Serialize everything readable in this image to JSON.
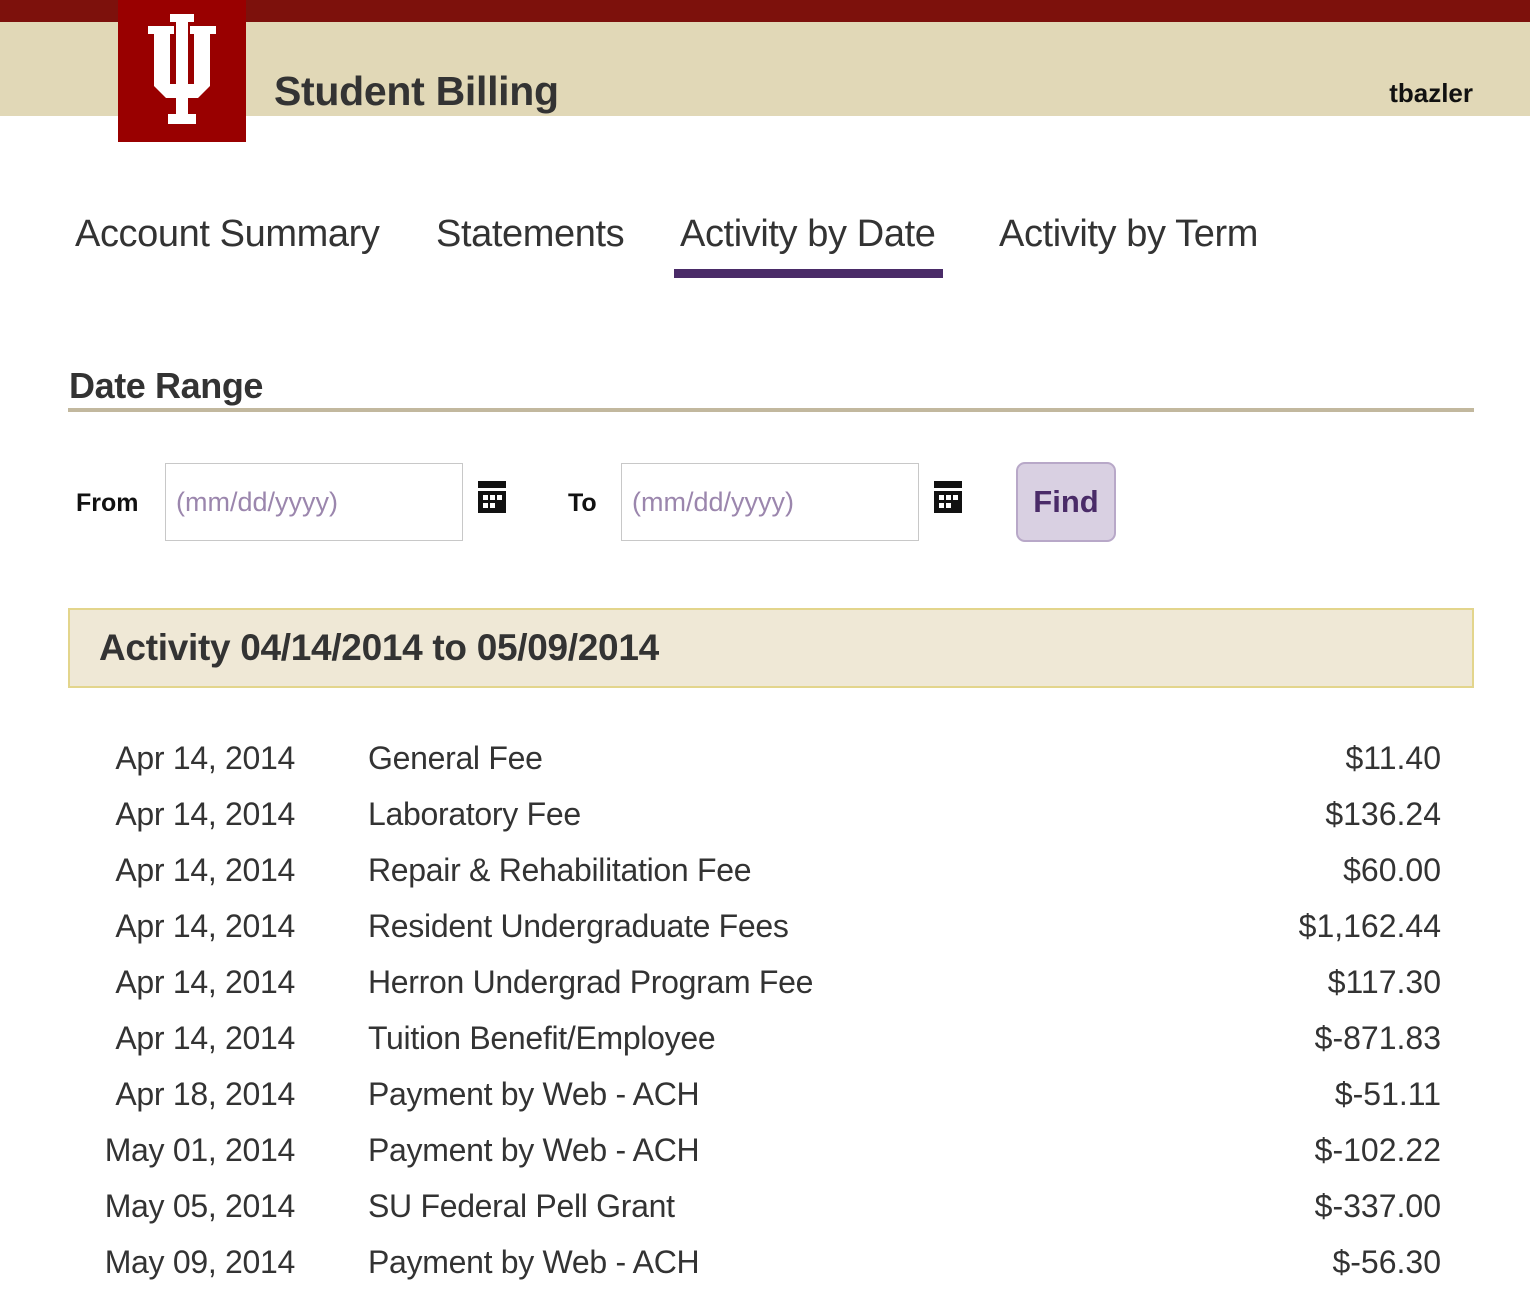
{
  "header": {
    "app_title": "Student Billing",
    "username": "tbazler",
    "logo": "iu-trident-logo"
  },
  "nav": {
    "tabs": [
      {
        "label": "Account Summary",
        "active": false
      },
      {
        "label": "Statements",
        "active": false
      },
      {
        "label": "Activity by Date",
        "active": true
      },
      {
        "label": "Activity by Term",
        "active": false
      }
    ]
  },
  "date_range": {
    "title": "Date Range",
    "from_label": "From",
    "to_label": "To",
    "from_value": "",
    "to_value": "",
    "from_placeholder": "(mm/dd/yyyy)",
    "to_placeholder": "(mm/dd/yyyy)",
    "calendar_icon": "calendar-icon",
    "find_label": "Find"
  },
  "activity": {
    "title": "Activity 04/14/2014 to 05/09/2014",
    "rows": [
      {
        "date": "Apr 14, 2014",
        "description": "General Fee",
        "amount": "$11.40"
      },
      {
        "date": "Apr 14, 2014",
        "description": "Laboratory Fee",
        "amount": "$136.24"
      },
      {
        "date": "Apr 14, 2014",
        "description": "Repair & Rehabilitation Fee",
        "amount": "$60.00"
      },
      {
        "date": "Apr 14, 2014",
        "description": "Resident Undergraduate Fees",
        "amount": "$1,162.44"
      },
      {
        "date": "Apr 14, 2014",
        "description": "Herron Undergrad Program Fee",
        "amount": "$117.30"
      },
      {
        "date": "Apr 14, 2014",
        "description": "Tuition Benefit/Employee",
        "amount": "$-871.83"
      },
      {
        "date": "Apr 18, 2014",
        "description": "Payment by Web - ACH",
        "amount": "$-51.11"
      },
      {
        "date": "May 01, 2014",
        "description": "Payment by Web - ACH",
        "amount": "$-102.22"
      },
      {
        "date": "May 05, 2014",
        "description": "SU Federal Pell Grant",
        "amount": "$-337.00"
      },
      {
        "date": "May 09, 2014",
        "description": "Payment by Web - ACH",
        "amount": "$-56.30"
      }
    ]
  },
  "colors": {
    "topbar": "#7d110c",
    "header_bg": "#e1d8b7",
    "logo_bg": "#990000",
    "active_tab_underline": "#4a2b68",
    "find_button_bg": "#d9d0e2",
    "find_button_text": "#4a2b68",
    "activity_header_bg": "#efe8d6",
    "activity_header_border": "#e3d58c",
    "placeholder_text": "#9b86ad"
  }
}
